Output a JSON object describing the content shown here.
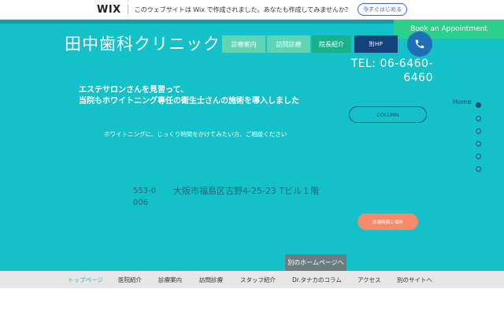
{
  "wix_banner": {
    "logo": "WIX",
    "text": "このウェブサイトは Wix で作成されました。あなたも作成してみませんか？",
    "cta": "今すぐはじめる"
  },
  "header": {
    "site_title": "田中歯科クリニック",
    "book_label": "Book an Appointment",
    "tabs": [
      "診療案内",
      "訪問診療",
      "院長紹介",
      "別HP"
    ],
    "phone_icon": "phone-icon",
    "tel": "TEL: 06-6460-6460"
  },
  "main": {
    "headline_line1": "エステサロンさんを見習って、",
    "headline_line2": "当院もホワイトニング専任の衛生士さんの施術を導入しました",
    "subtext": "ホワイトニングに、じっくり時間をかけてみたい方、ご相談ください",
    "column_label": "COLUMN",
    "zip": "553-0006",
    "address": "大阪市福島区吉野4-25-23 Tビル１階",
    "contact_label": "診療時間と場所",
    "home_link": "別のホームページへ"
  },
  "side_nav": {
    "home_label": "Home"
  },
  "bottom_nav": {
    "items": [
      "トップページ",
      "医院紹介",
      "診療案内",
      "訪問診療",
      "スタッフ紹介",
      "Dr.タナカのコラム",
      "アクセス",
      "別のサイトへ"
    ]
  },
  "colors": {
    "teal": "#14c1c8",
    "accent_green": "#2bd08a",
    "navy": "#1a4d78",
    "coral": "#f48a6a"
  }
}
